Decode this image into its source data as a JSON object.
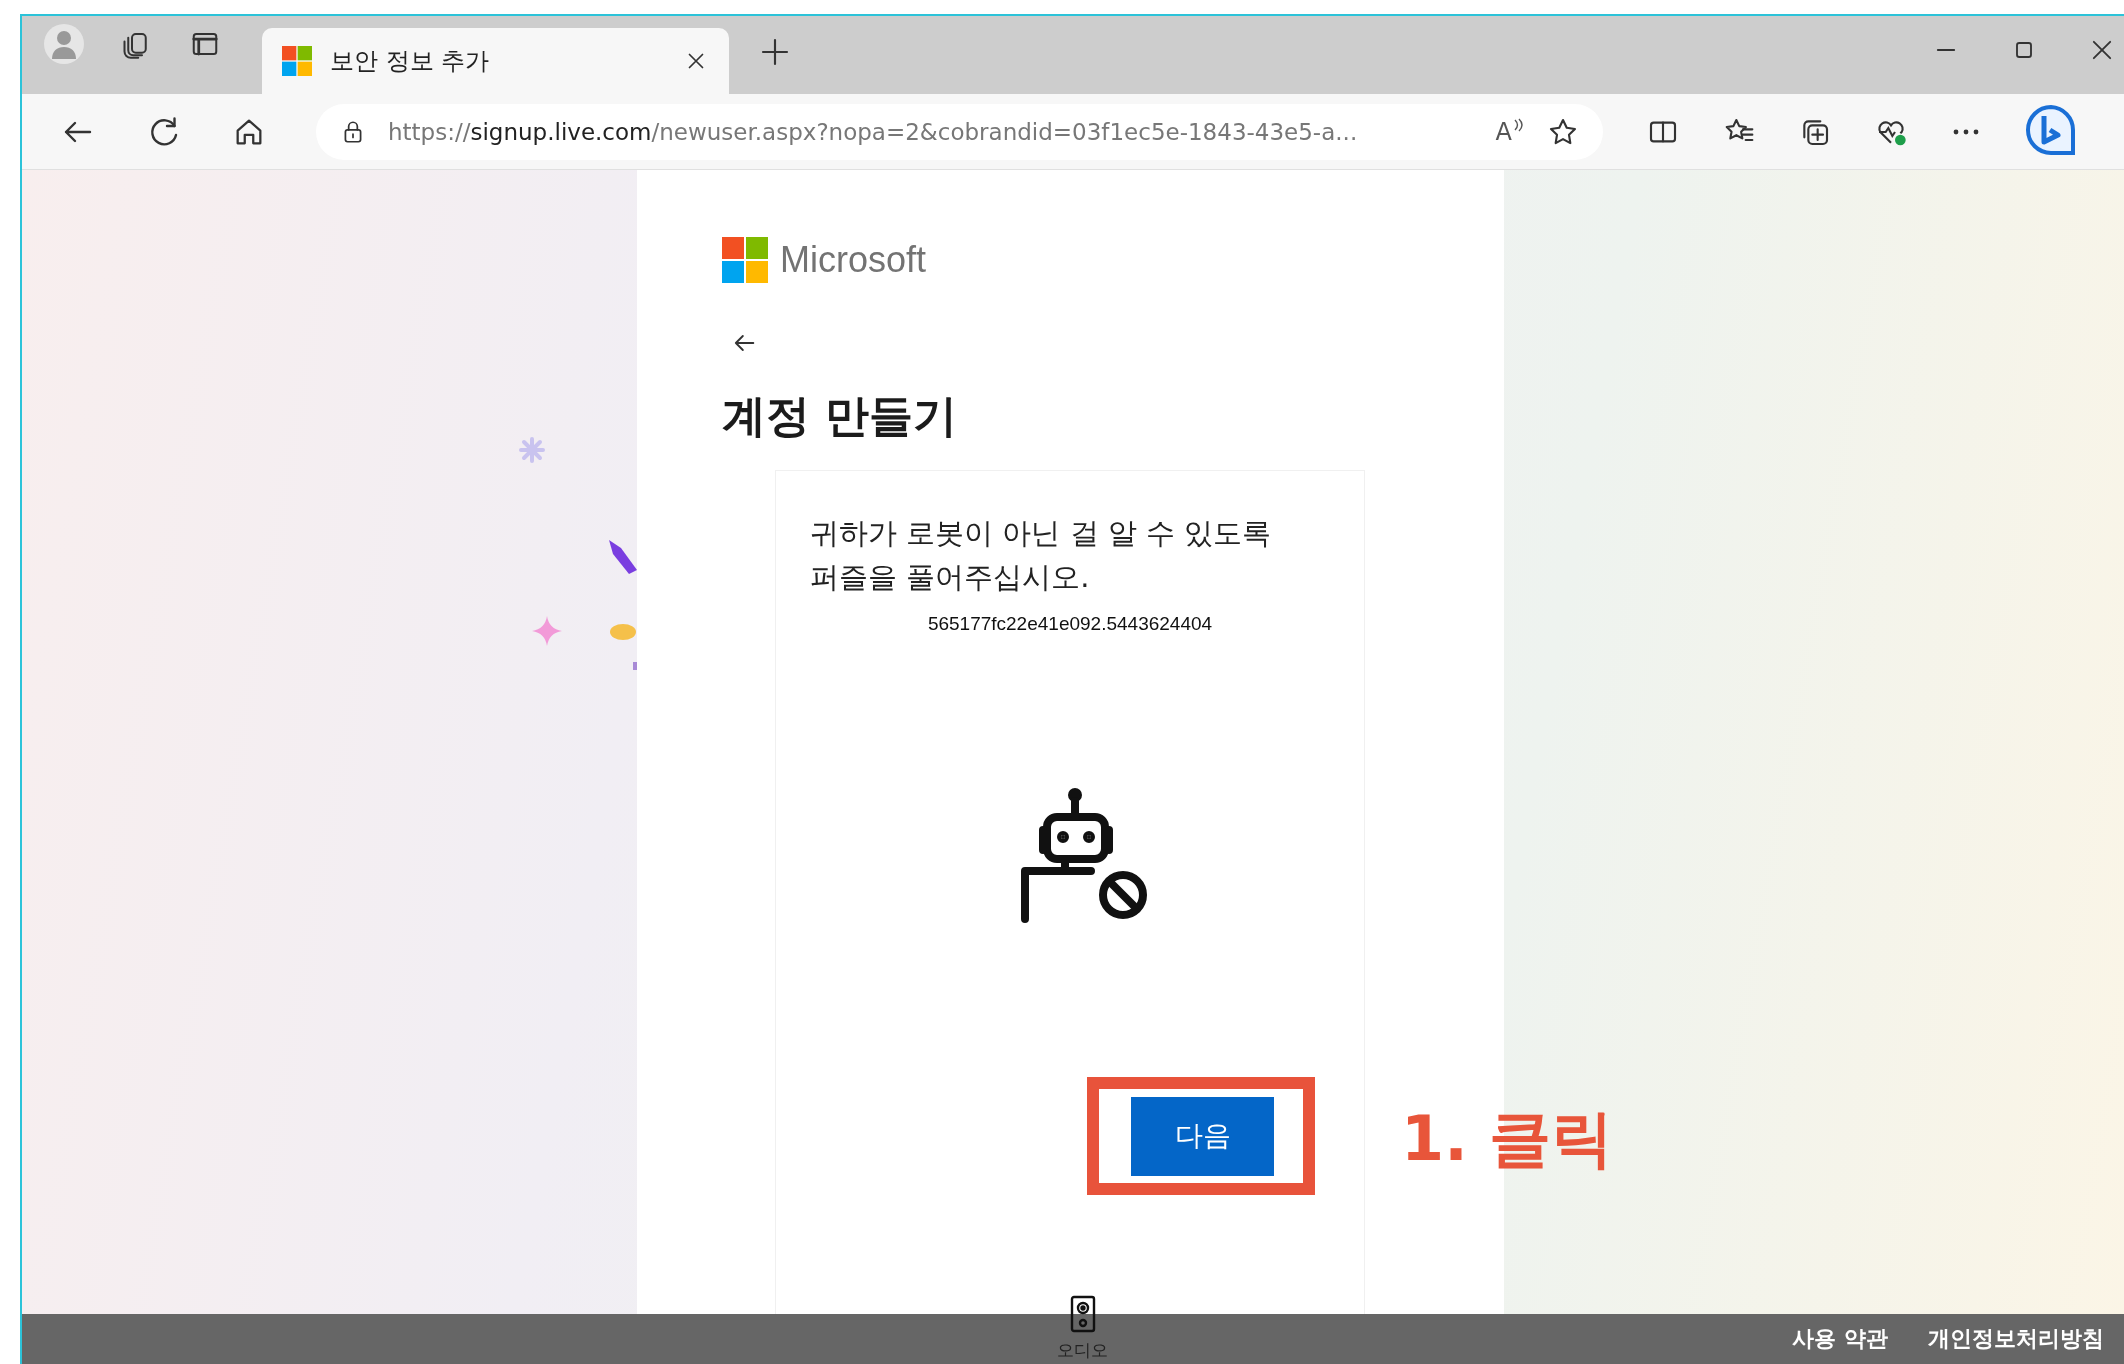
{
  "browser": {
    "tab": {
      "title": "보안 정보 추가",
      "selected": true
    },
    "address": "https://**signup.live.com**/newuser.aspx?nopa=2&cobrandid=03f1ec5e-1843-43e5-a...",
    "read_aloud": "A"
  },
  "page": {
    "brand": "Microsoft",
    "heading": "계정 만들기",
    "instruction": "귀하가 로봇이 아닌 걸 알 수 있도록\n퍼즐을 풀어주십시오.",
    "code": "565177fc22e41e092.5443624404",
    "next_button": "다음",
    "audio_label": "오디오"
  },
  "annotation": {
    "label": "1. 클릭"
  },
  "footer": {
    "links": [
      "사용 약관",
      "개인정보처리방침"
    ]
  }
}
